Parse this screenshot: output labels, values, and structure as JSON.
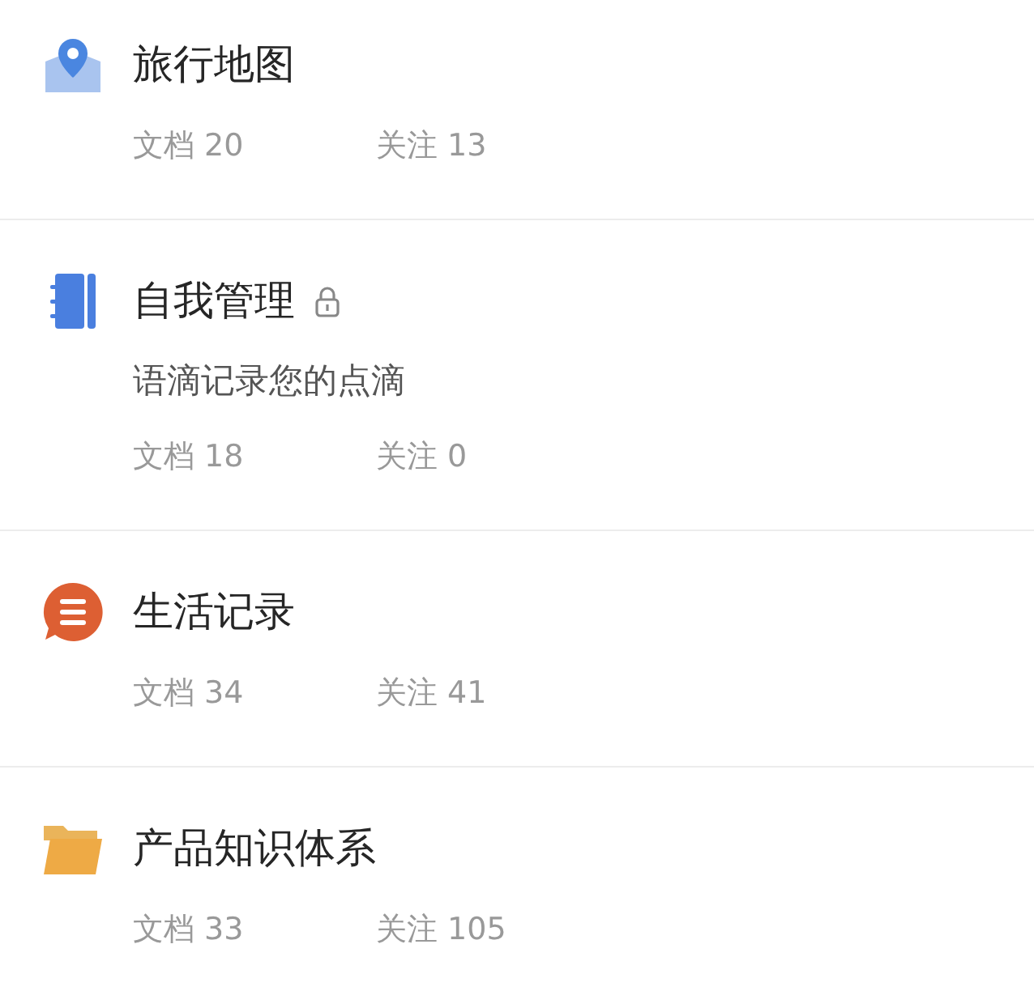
{
  "books": [
    {
      "kind": "map",
      "title": "旅行地图",
      "locked": false,
      "stats": [
        {
          "label": "文档",
          "count": "20"
        },
        {
          "label": "关注",
          "count": "13"
        }
      ]
    },
    {
      "kind": "notebook",
      "title": "自我管理",
      "locked": true,
      "description": "语滴记录您的点滴",
      "stats": [
        {
          "label": "文档",
          "count": "18"
        },
        {
          "label": "关注",
          "count": "0"
        }
      ]
    },
    {
      "kind": "chat",
      "title": "生活记录",
      "locked": false,
      "stats": [
        {
          "label": "文档",
          "count": "34"
        },
        {
          "label": "关注",
          "count": "41"
        }
      ]
    },
    {
      "kind": "folder",
      "title": "产品知识体系",
      "locked": false,
      "stats": [
        {
          "label": "文档",
          "count": "33"
        },
        {
          "label": "关注",
          "count": "105"
        }
      ]
    }
  ]
}
